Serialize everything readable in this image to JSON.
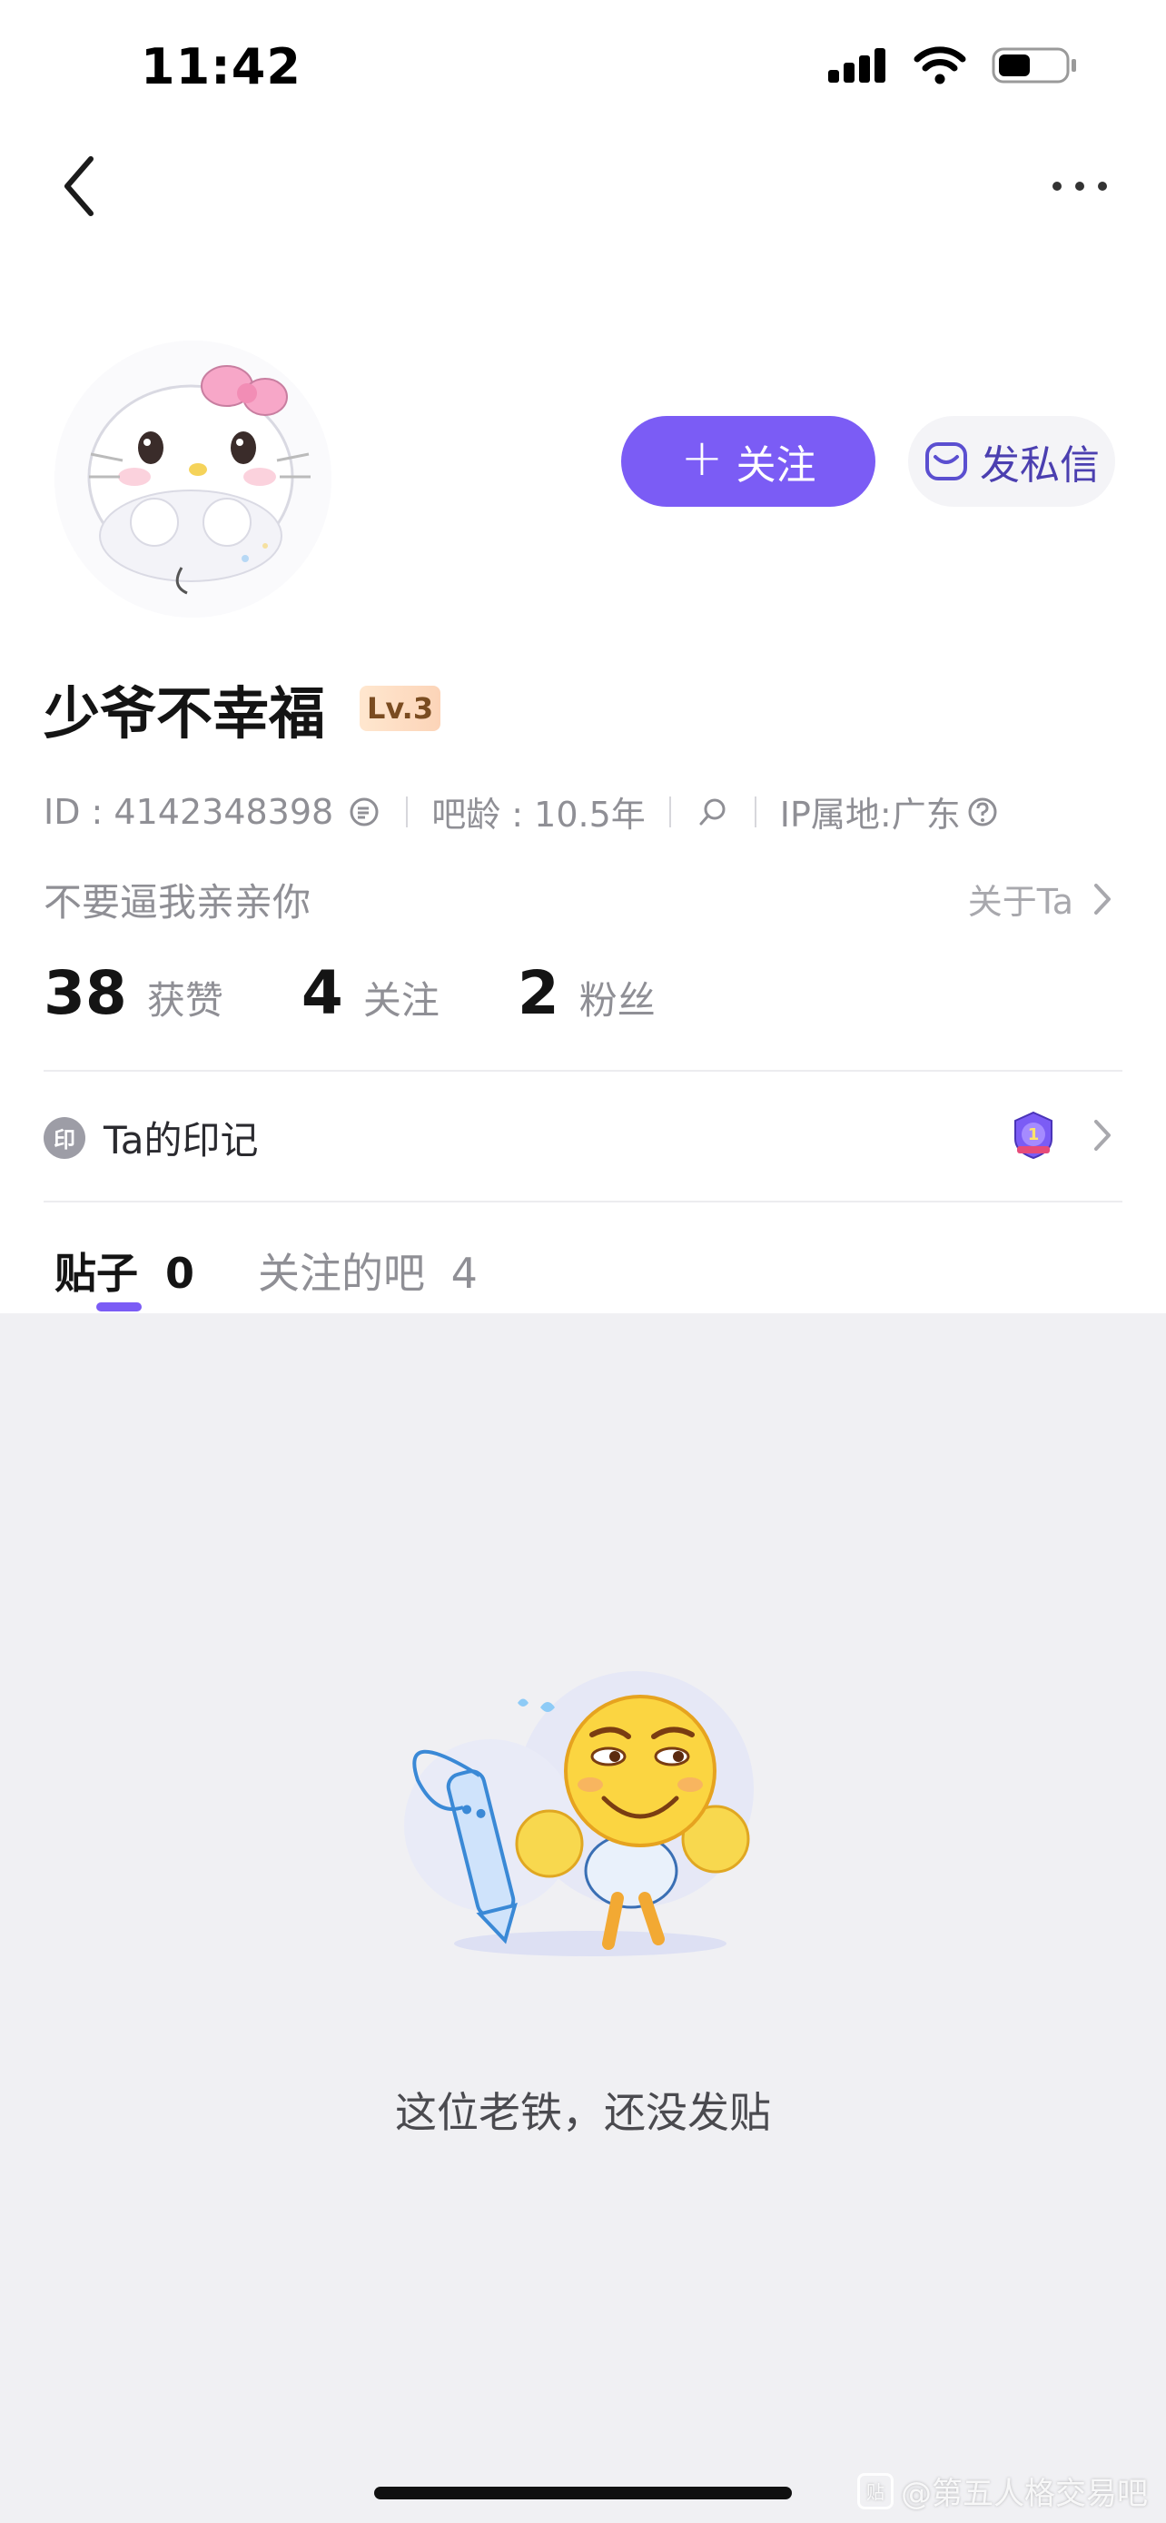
{
  "status_bar": {
    "time": "11:42"
  },
  "profile": {
    "username": "少爷不幸福",
    "level": "Lv.3",
    "id_text": "ID : 4142348398",
    "bar_age": "吧龄 : 10.5年",
    "ip_location": "IP属地:广东",
    "bio": "不要逼我亲亲你",
    "about_link": "关于Ta"
  },
  "actions": {
    "follow_icon": "+",
    "follow_label": "关注",
    "message_label": "发私信"
  },
  "stats": [
    {
      "value": "38",
      "label": "获赞"
    },
    {
      "value": "4",
      "label": "关注"
    },
    {
      "value": "2",
      "label": "粉丝"
    }
  ],
  "marks": {
    "icon_text": "印",
    "label": "Ta的印记",
    "badge_number": "1"
  },
  "tabs": [
    {
      "label": "贴子",
      "count": "0",
      "active": true
    },
    {
      "label": "关注的吧",
      "count": "4",
      "active": false
    }
  ],
  "empty_state": {
    "message": "这位老铁，还没发贴"
  },
  "watermark": {
    "icon": "贴",
    "text": "@第五人格交易吧"
  },
  "colors": {
    "accent": "#7b5cf5",
    "background": "#f0f0f3"
  }
}
